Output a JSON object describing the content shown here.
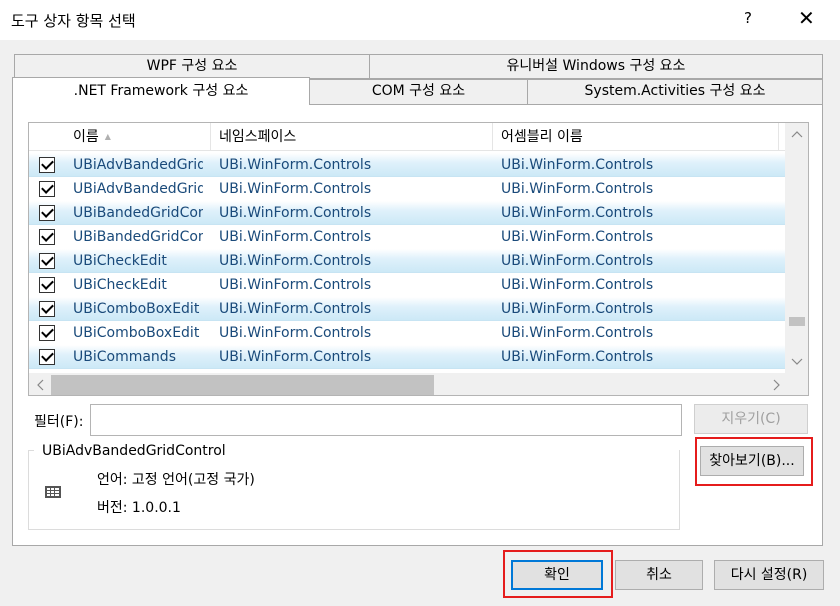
{
  "window": {
    "title": "도구 상자 항목 선택",
    "help": "?",
    "close": "✕"
  },
  "tabs": {
    "row1": [
      "WPF 구성 요소",
      "유니버설 Windows 구성 요소"
    ],
    "row2": [
      ".NET Framework 구성 요소",
      "COM 구성 요소",
      "System.Activities 구성 요소"
    ],
    "active": ".NET Framework 구성 요소"
  },
  "list": {
    "columns": [
      "이름",
      "네임스페이스",
      "어셈블리 이름"
    ],
    "rows": [
      {
        "checked": true,
        "selected": true,
        "name": "UBiAdvBandedGrid",
        "ns": "UBi.WinForm.Controls",
        "asm": "UBi.WinForm.Controls"
      },
      {
        "checked": true,
        "selected": false,
        "name": "UBiAdvBandedGrid",
        "ns": "UBi.WinForm.Controls",
        "asm": "UBi.WinForm.Controls"
      },
      {
        "checked": true,
        "selected": true,
        "name": "UBiBandedGridCon",
        "ns": "UBi.WinForm.Controls",
        "asm": "UBi.WinForm.Controls"
      },
      {
        "checked": true,
        "selected": false,
        "name": "UBiBandedGridCon",
        "ns": "UBi.WinForm.Controls",
        "asm": "UBi.WinForm.Controls"
      },
      {
        "checked": true,
        "selected": true,
        "name": "UBiCheckEdit",
        "ns": "UBi.WinForm.Controls",
        "asm": "UBi.WinForm.Controls"
      },
      {
        "checked": true,
        "selected": false,
        "name": "UBiCheckEdit",
        "ns": "UBi.WinForm.Controls",
        "asm": "UBi.WinForm.Controls"
      },
      {
        "checked": true,
        "selected": true,
        "name": "UBiComboBoxEdit",
        "ns": "UBi.WinForm.Controls",
        "asm": "UBi.WinForm.Controls"
      },
      {
        "checked": true,
        "selected": false,
        "name": "UBiComboBoxEdit",
        "ns": "UBi.WinForm.Controls",
        "asm": "UBi.WinForm.Controls"
      },
      {
        "checked": true,
        "selected": true,
        "name": "UBiCommands",
        "ns": "UBi.WinForm.Controls",
        "asm": "UBi.WinForm.Controls"
      }
    ]
  },
  "filter": {
    "label": "필터(F):",
    "value": "",
    "clear_button": "지우기(C)"
  },
  "browse_button": "찾아보기(B)...",
  "info": {
    "group_title": "UBiAdvBandedGridControl",
    "language": "언어:  고정 언어(고정 국가)",
    "version": "버전:  1.0.0.1"
  },
  "buttons": {
    "ok": "확인",
    "cancel": "취소",
    "reset": "다시 설정(R)"
  },
  "colors": {
    "highlight_red": "#e51c1c",
    "selected_row": "#cbe8f6",
    "focus_blue": "#0078d7"
  }
}
